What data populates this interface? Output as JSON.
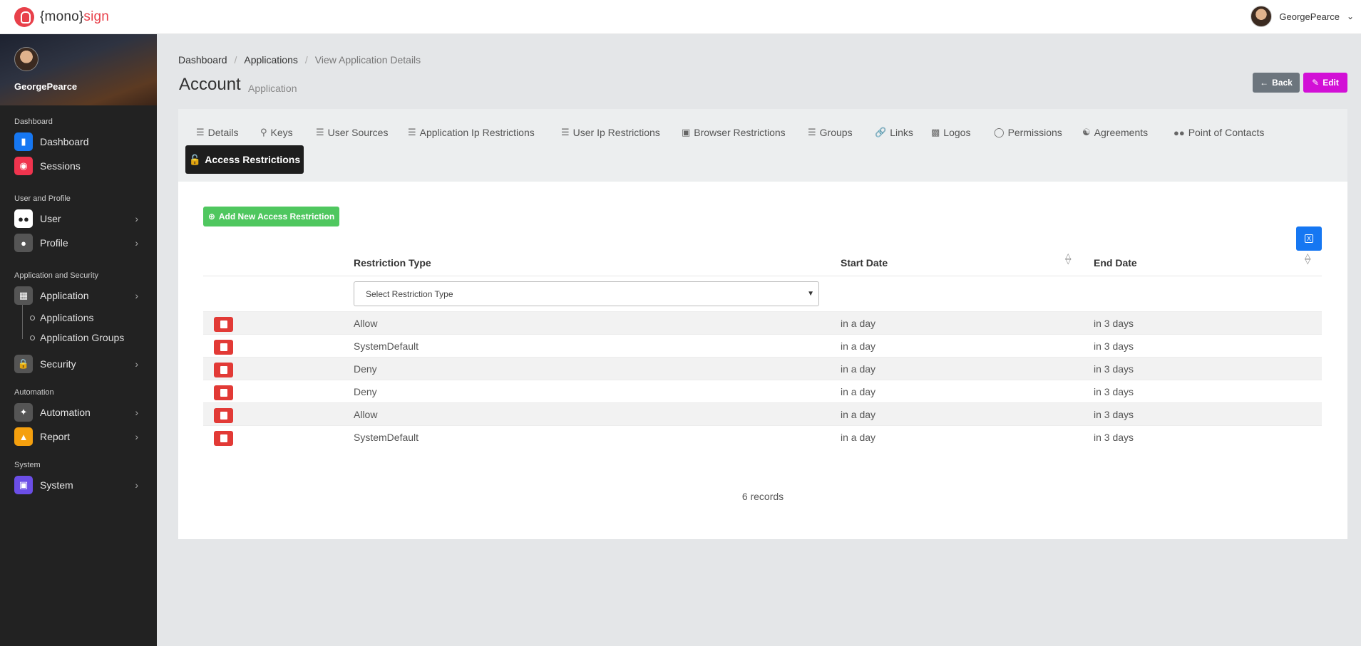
{
  "brand": {
    "prefix": "{mono}",
    "suffix": "sign"
  },
  "user": {
    "name": "GeorgePearce"
  },
  "sidebar": {
    "profile_name": "GeorgePearce",
    "sections": {
      "dashboard": "Dashboard",
      "user_profile": "User and Profile",
      "app_security": "Application and Security",
      "automation": "Automation",
      "system": "System"
    },
    "items": {
      "dashboard": "Dashboard",
      "sessions": "Sessions",
      "user": "User",
      "profile": "Profile",
      "application": "Application",
      "applications": "Applications",
      "application_groups": "Application Groups",
      "security": "Security",
      "automation": "Automation",
      "report": "Report",
      "system": "System"
    }
  },
  "breadcrumb": [
    "Dashboard",
    "Applications",
    "View Application Details"
  ],
  "page": {
    "title": "Account",
    "subtitle": "Application"
  },
  "actions": {
    "back": "Back",
    "edit": "Edit"
  },
  "tabs": [
    "Details",
    "Keys",
    "User Sources",
    "Application Ip Restrictions",
    "User Ip Restrictions",
    "Browser Restrictions",
    "Groups",
    "Links",
    "Logos",
    "Permissions",
    "Agreements",
    "Point of Contacts"
  ],
  "active_tab": "Access Restrictions",
  "add_button": "Add New Access Restriction",
  "table": {
    "columns": {
      "type": "Restriction Type",
      "start": "Start Date",
      "end": "End Date"
    },
    "filter_placeholder": "Select Restriction Type",
    "rows": [
      {
        "type": "Allow",
        "start": "in a day",
        "end": "in 3 days"
      },
      {
        "type": "SystemDefault",
        "start": "in a day",
        "end": "in 3 days"
      },
      {
        "type": "Deny",
        "start": "in a day",
        "end": "in 3 days"
      },
      {
        "type": "Deny",
        "start": "in a day",
        "end": "in 3 days"
      },
      {
        "type": "Allow",
        "start": "in a day",
        "end": "in 3 days"
      },
      {
        "type": "SystemDefault",
        "start": "in a day",
        "end": "in 3 days"
      }
    ],
    "record_count": "6 records"
  },
  "colors": {
    "brand": "#e8404a",
    "edit": "#d210d6",
    "add": "#4fc75f",
    "excel": "#1677f2",
    "delete": "#e23a36"
  }
}
